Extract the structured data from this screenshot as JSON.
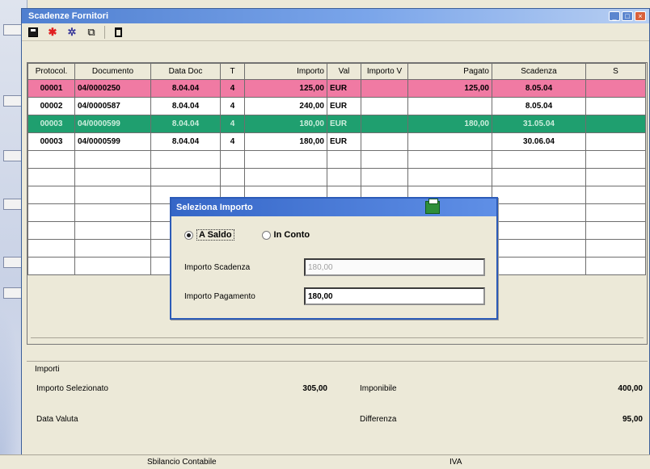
{
  "window": {
    "title": "Scadenze Fornitori"
  },
  "toolbar": {
    "icons": [
      "save-icon",
      "new-icon",
      "settings-icon",
      "copy-icon",
      "delete-icon"
    ]
  },
  "grid": {
    "columns": [
      "Protocol.",
      "Documento",
      "Data Doc",
      "T",
      "Importo",
      "Val",
      "Importo V",
      "Pagato",
      "Scadenza",
      "S"
    ],
    "rows": [
      {
        "protocol": "00001",
        "documento": "04/0000250",
        "data_doc": "8.04.04",
        "t": "4",
        "importo": "125,00",
        "val": "EUR",
        "importo_v": "",
        "pagato": "125,00",
        "scadenza": "8.05.04",
        "s": "",
        "highlight": "pink"
      },
      {
        "protocol": "00002",
        "documento": "04/0000587",
        "data_doc": "8.04.04",
        "t": "4",
        "importo": "240,00",
        "val": "EUR",
        "importo_v": "",
        "pagato": "",
        "scadenza": "8.05.04",
        "s": "",
        "highlight": ""
      },
      {
        "protocol": "00003",
        "documento": "04/0000599",
        "data_doc": "8.04.04",
        "t": "4",
        "importo": "180,00",
        "val": "EUR",
        "importo_v": "",
        "pagato": "180,00",
        "scadenza": "31.05.04",
        "s": "",
        "highlight": "green"
      },
      {
        "protocol": "00003",
        "documento": "04/0000599",
        "data_doc": "8.04.04",
        "t": "4",
        "importo": "180,00",
        "val": "EUR",
        "importo_v": "",
        "pagato": "",
        "scadenza": "30.06.04",
        "s": "",
        "highlight": ""
      }
    ],
    "empty_rows": 7
  },
  "dialog": {
    "title": "Seleziona Importo",
    "radio_saldo": "A Saldo",
    "radio_conto": "In Conto",
    "label_scadenza": "Importo Scadenza",
    "value_scadenza": "180,00",
    "label_pagamento": "Importo Pagamento",
    "value_pagamento": "180,00"
  },
  "summary": {
    "section": "Importi",
    "importo_selezionato_label": "Importo Selezionato",
    "importo_selezionato_value": "305,00",
    "imponibile_label": "Imponibile",
    "imponibile_value": "400,00",
    "data_valuta_label": "Data Valuta",
    "differenza_label": "Differenza",
    "differenza_value": "95,00"
  },
  "status": {
    "left": "Sbilancio Contabile",
    "right": "IVA"
  },
  "colors": {
    "pink_row": "#f07aa3",
    "green_row": "#1f9f6f",
    "titlebar": "#4f7fd0"
  }
}
